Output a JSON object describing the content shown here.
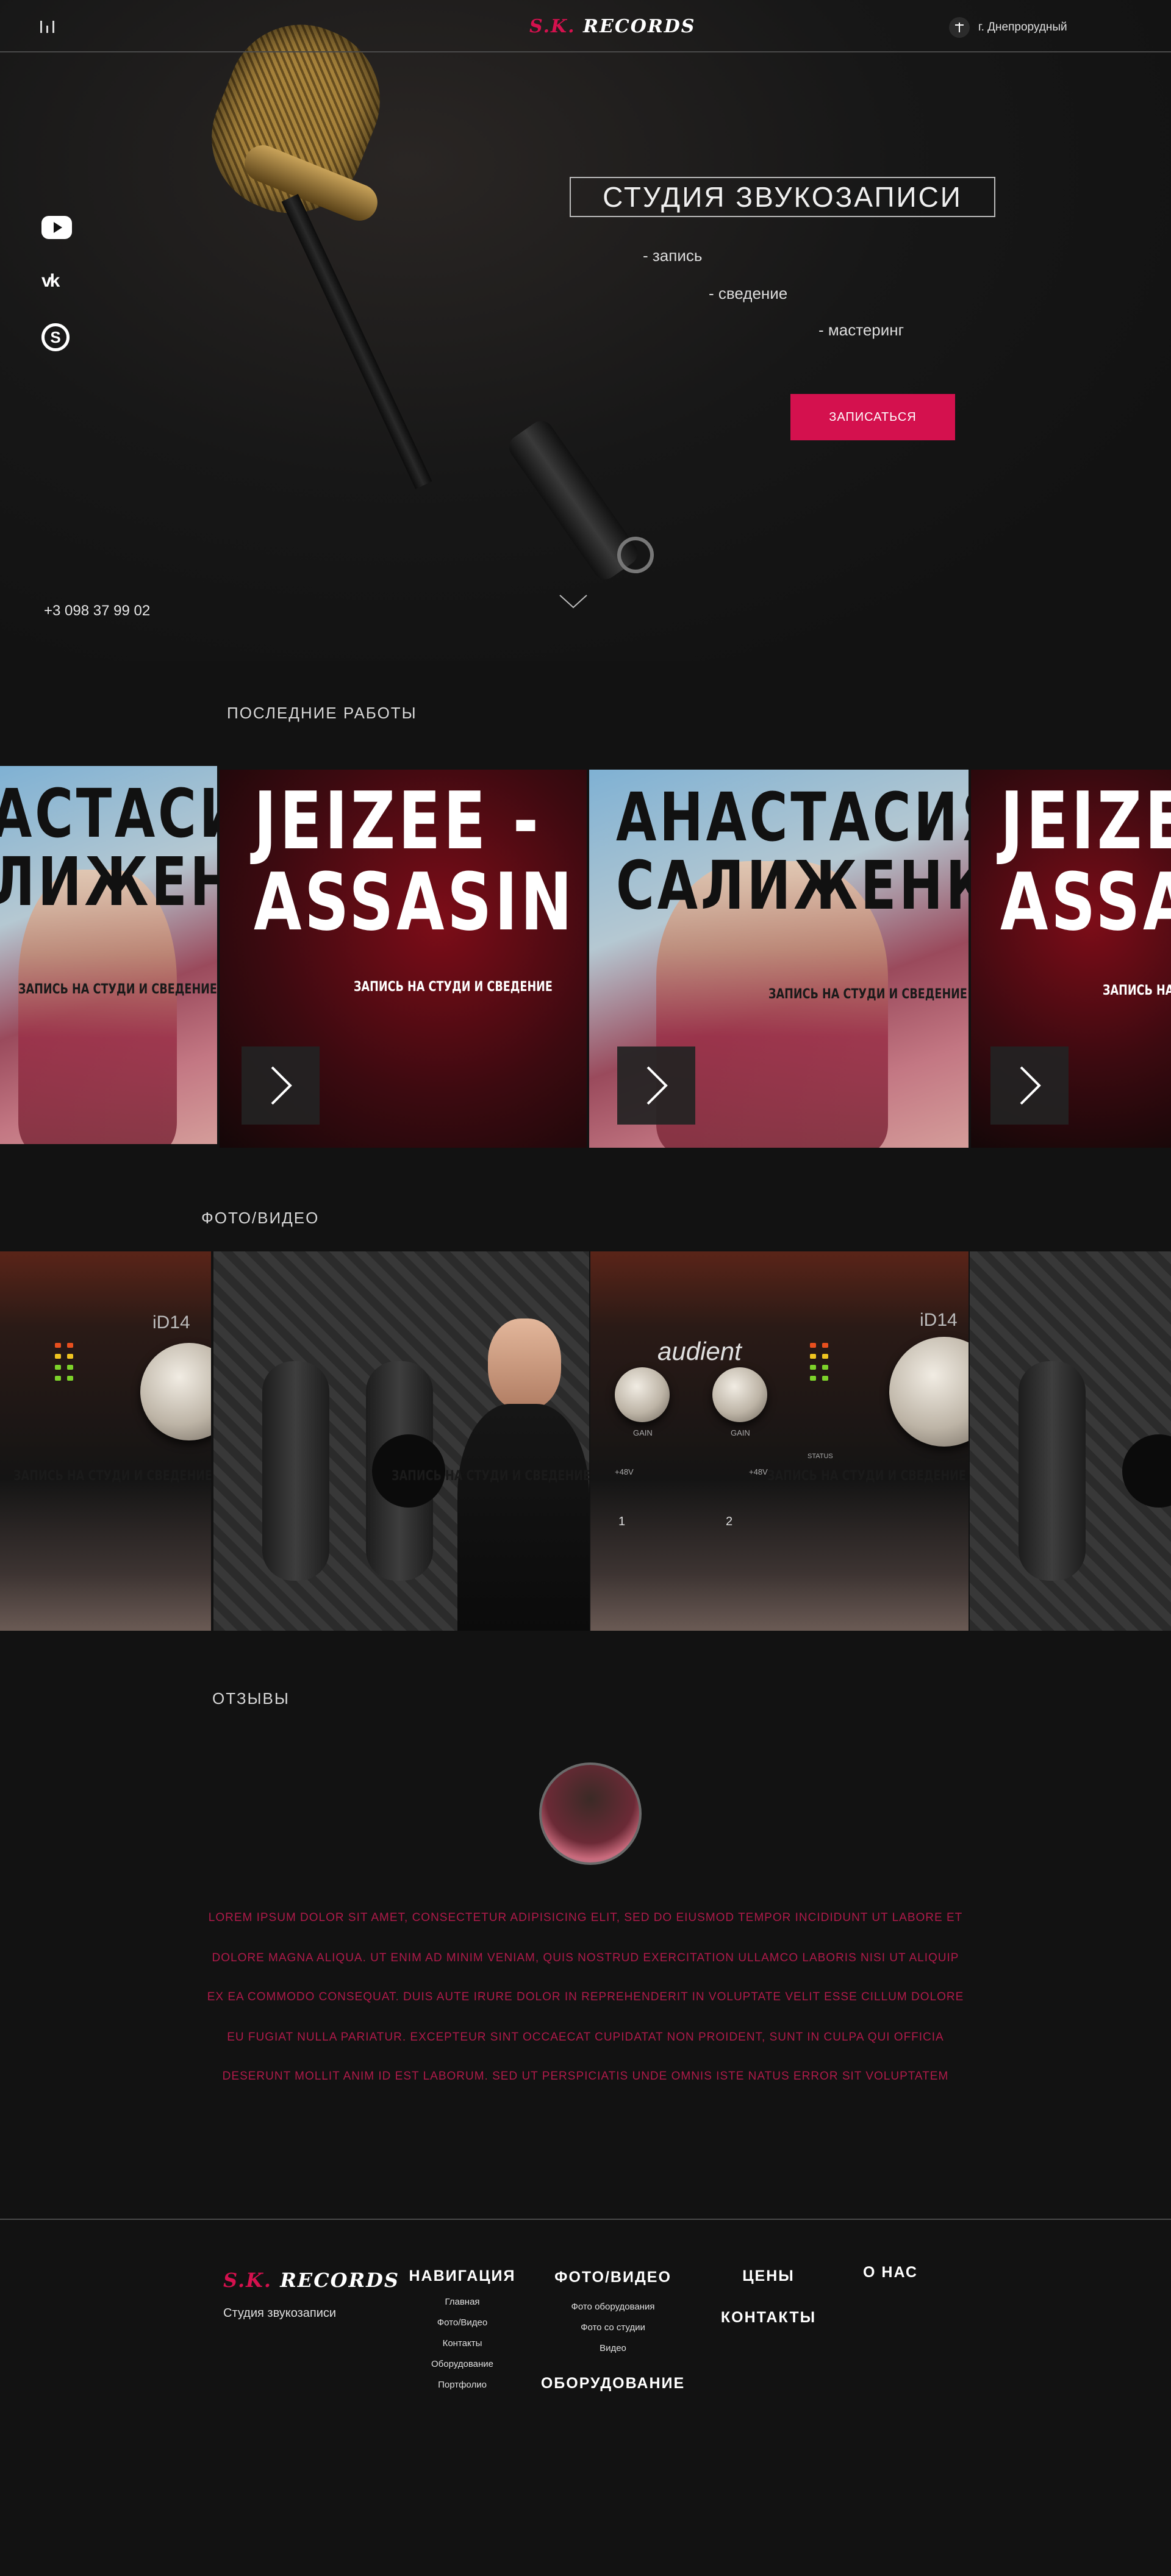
{
  "header": {
    "logo_sk": "S.K.",
    "logo_records": "RECORDS",
    "location": "г. Днепрорудный"
  },
  "hero": {
    "title": "СТУДИЯ ЗВУКОЗАПИСИ",
    "services": [
      "- запись",
      "- сведение",
      "- мастеринг"
    ],
    "cta": "ЗАПИСАТЬСЯ",
    "phone": "+3 098 37 99 02",
    "social_icons": [
      "youtube-icon",
      "vk-icon",
      "skype-icon"
    ]
  },
  "works": {
    "title": "ПОСЛЕДНИЕ РАБОТЫ",
    "cards": [
      {
        "line1": "АСТАСИЯ",
        "line2": "ЛИЖЕНКО",
        "subtitle": "ЗАПИСЬ НА СТУДИ И СВЕДЕНИЕ"
      },
      {
        "line1": "JEIZEE -",
        "line2": "ASSASIN",
        "subtitle": "ЗАПИСЬ НА СТУДИ И СВЕДЕНИЕ"
      },
      {
        "line1": "АНАСТАСИЯ",
        "line2": "САЛИЖЕНКО",
        "subtitle": "ЗАПИСЬ НА СТУДИ И СВЕДЕНИЕ"
      },
      {
        "line1": "JEIZE",
        "line2": "ASSA",
        "subtitle": "ЗАПИСЬ НА"
      }
    ]
  },
  "media": {
    "title": "ФОТО/ВИДЕО",
    "captions": [
      "ЗАПИСЬ НА СТУДИ И СВЕДЕНИЕ",
      "ЗАПИСЬ НА СТУДИ И СВЕДЕНИЕ",
      "ЗАПИСЬ НА СТУДИ И СВЕДЕНИЕ"
    ],
    "device_model": "iD14",
    "device_brand": "audient",
    "device_labels": [
      "GAIN",
      "GAIN",
      "+48V",
      "+48V",
      "1",
      "2",
      "STATUS"
    ]
  },
  "reviews": {
    "title": "ОТЗЫВЫ",
    "lines": [
      "LOREM IPSUM DOLOR SIT AMET, CONSECTETUR ADIPISICING ELIT, SED DO EIUSMOD TEMPOR INCIDIDUNT UT LABORE ET",
      "DOLORE MAGNA ALIQUA. UT ENIM AD MINIM VENIAM, QUIS NOSTRUD EXERCITATION ULLAMCO LABORIS NISI UT ALIQUIP",
      "EX EA COMMODO CONSEQUAT. DUIS AUTE IRURE DOLOR IN REPREHENDERIT IN VOLUPTATE VELIT ESSE CILLUM DOLORE",
      "EU FUGIAT NULLA PARIATUR. EXCEPTEUR SINT OCCAECAT CUPIDATAT NON PROIDENT, SUNT IN CULPA QUI OFFICIA",
      "DESERUNT MOLLIT ANIM ID EST LABORUM. SED UT PERSPICIATIS UNDE OMNIS ISTE NATUS ERROR SIT VOLUPTATEM"
    ]
  },
  "footer": {
    "logo_sk": "S.K.",
    "logo_records": "RECORDS",
    "tagline": "Студия звукозаписи",
    "nav_title": "НАВИГАЦИЯ",
    "nav_links": [
      "Главная",
      "Фото/Видео",
      "Контакты",
      "Оборудование",
      "Портфолио"
    ],
    "media_title": "ФОТО/ВИДЕО",
    "media_links": [
      "Фото оборудования",
      "Фото со студии",
      "Видео"
    ],
    "equipment": "ОБОРУДОВАНИЕ",
    "prices": "ЦЕНЫ",
    "contacts": "КОНТАКТЫ",
    "about": "О НАС"
  },
  "colors": {
    "accent": "#d4114e",
    "background": "#121212",
    "review_text": "#b01a4a"
  }
}
